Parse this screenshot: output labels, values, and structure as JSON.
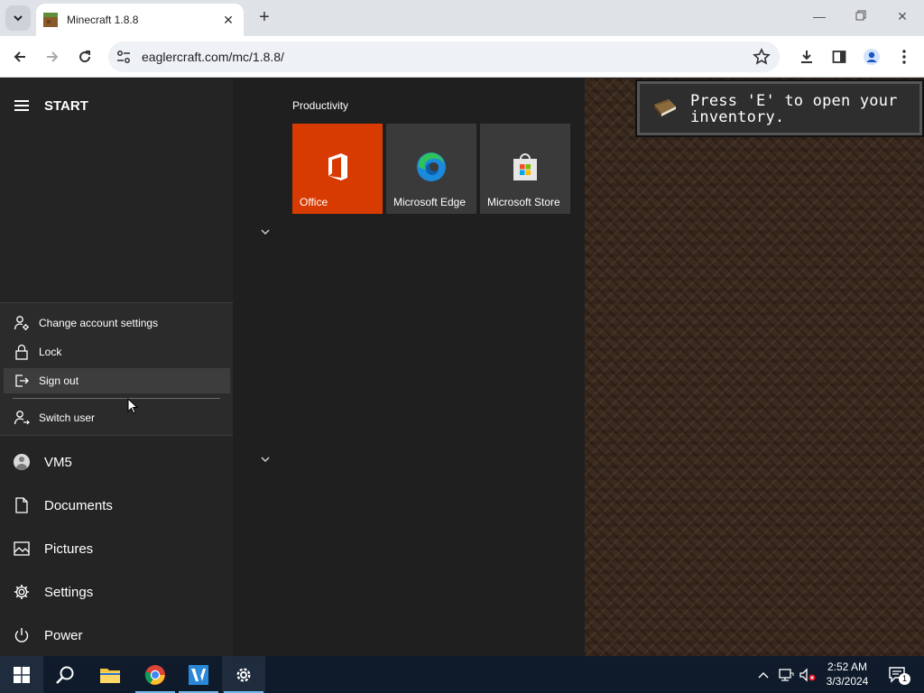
{
  "browser": {
    "tab_title": "Minecraft 1.8.8",
    "url": "eaglercraft.com/mc/1.8.8/"
  },
  "start_menu": {
    "title": "START",
    "account_flyout": [
      {
        "label": "Change account settings",
        "icon": "person-gear-icon"
      },
      {
        "label": "Lock",
        "icon": "lock-icon"
      },
      {
        "label": "Sign out",
        "icon": "sign-out-icon",
        "highlighted": true
      },
      {
        "label": "Switch user",
        "icon": "switch-user-icon"
      }
    ],
    "nav": [
      {
        "label": "VM5",
        "icon": "user-avatar-icon"
      },
      {
        "label": "Documents",
        "icon": "document-icon"
      },
      {
        "label": "Pictures",
        "icon": "pictures-icon"
      },
      {
        "label": "Settings",
        "icon": "gear-icon"
      },
      {
        "label": "Power",
        "icon": "power-icon"
      }
    ],
    "tile_group": "Productivity",
    "tiles": [
      {
        "label": "Office",
        "icon": "office-icon",
        "color": "#d83b01"
      },
      {
        "label": "Microsoft Edge",
        "icon": "edge-icon",
        "color": "#3a3a3a"
      },
      {
        "label": "Microsoft Store",
        "icon": "store-icon",
        "color": "#3a3a3a"
      }
    ]
  },
  "game": {
    "toast_line1": "Press 'E' to open your",
    "toast_line2": "inventory."
  },
  "taskbar": {
    "pinned": [
      "windows-start-icon",
      "search-icon",
      "file-explorer-icon",
      "chrome-icon",
      "visual-studio-icon",
      "settings-gear-icon"
    ],
    "time": "2:52 AM",
    "date": "3/3/2024",
    "notification_count": "1"
  },
  "colors": {
    "accent": "#76b9ed",
    "office": "#d83b01",
    "taskbar": "#0f1b2b",
    "start_bg": "#1f1f1f"
  }
}
